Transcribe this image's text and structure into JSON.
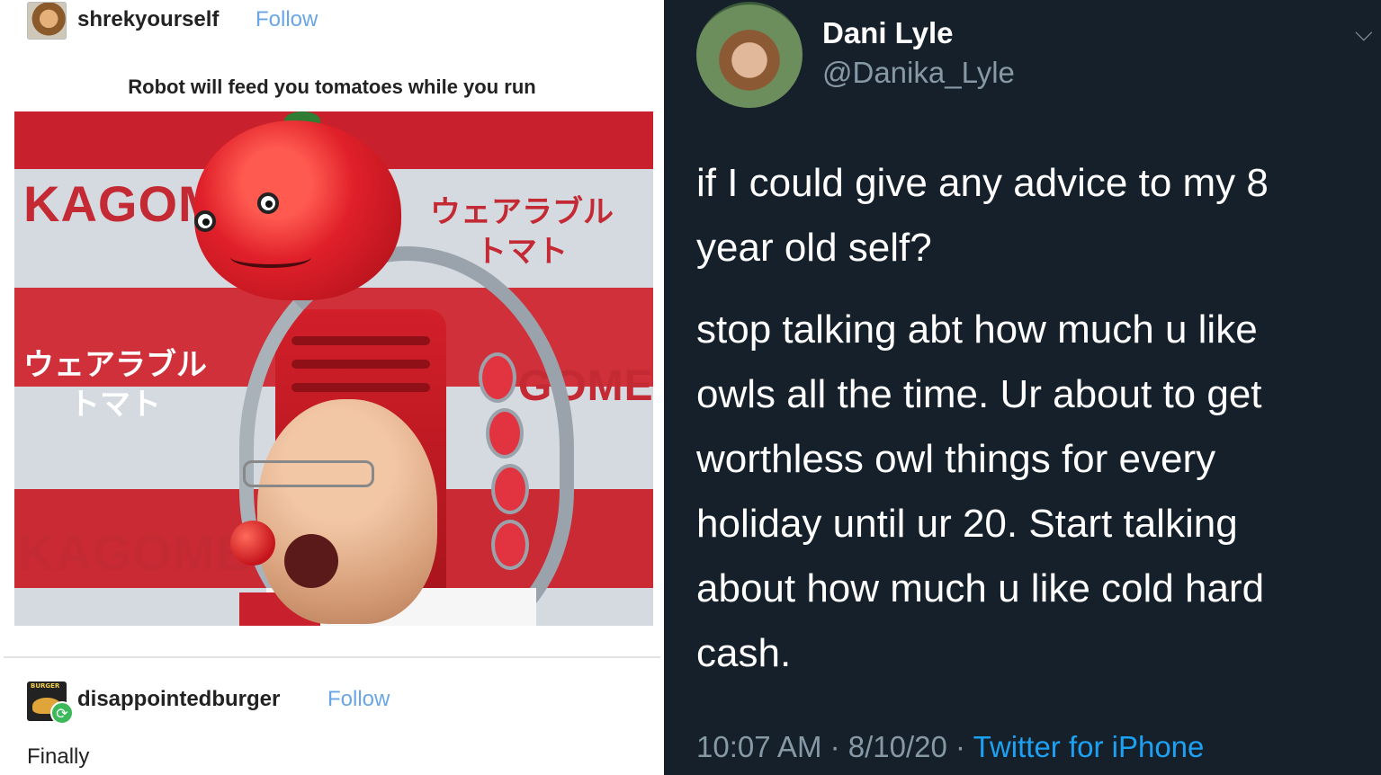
{
  "tumblr": {
    "post1": {
      "username": "shrekyourself",
      "follow_label": "Follow",
      "caption": "Robot will feed you tomatoes while you run"
    },
    "photo": {
      "brand_top": "KAGOME",
      "brand_mid": "GOME",
      "brand_bottom": "KAGOME",
      "jp_line1": "ウェアラブル",
      "jp_line2": "トマト",
      "avatar_badge": "BURGER"
    },
    "post2": {
      "username": "disappointedburger",
      "follow_label": "Follow",
      "text": "Finally"
    }
  },
  "tweet": {
    "display_name": "Dani Lyle",
    "handle": "@Danika_Lyle",
    "paragraph1": "if I could give any advice to my 8 year old self?",
    "paragraph2": "stop talking abt how much u like owls all the time. Ur about to get worthless owl things for every holiday until ur 20. Start talking about how much u like cold hard cash.",
    "time": "10:07 AM",
    "date": "8/10/20",
    "source": "Twitter for iPhone",
    "separator": " · "
  },
  "colors": {
    "tweet_bg": "#15202b",
    "link_blue": "#1da1f2",
    "tumblr_follow": "#6aa6e6",
    "muted": "#8899a6"
  }
}
